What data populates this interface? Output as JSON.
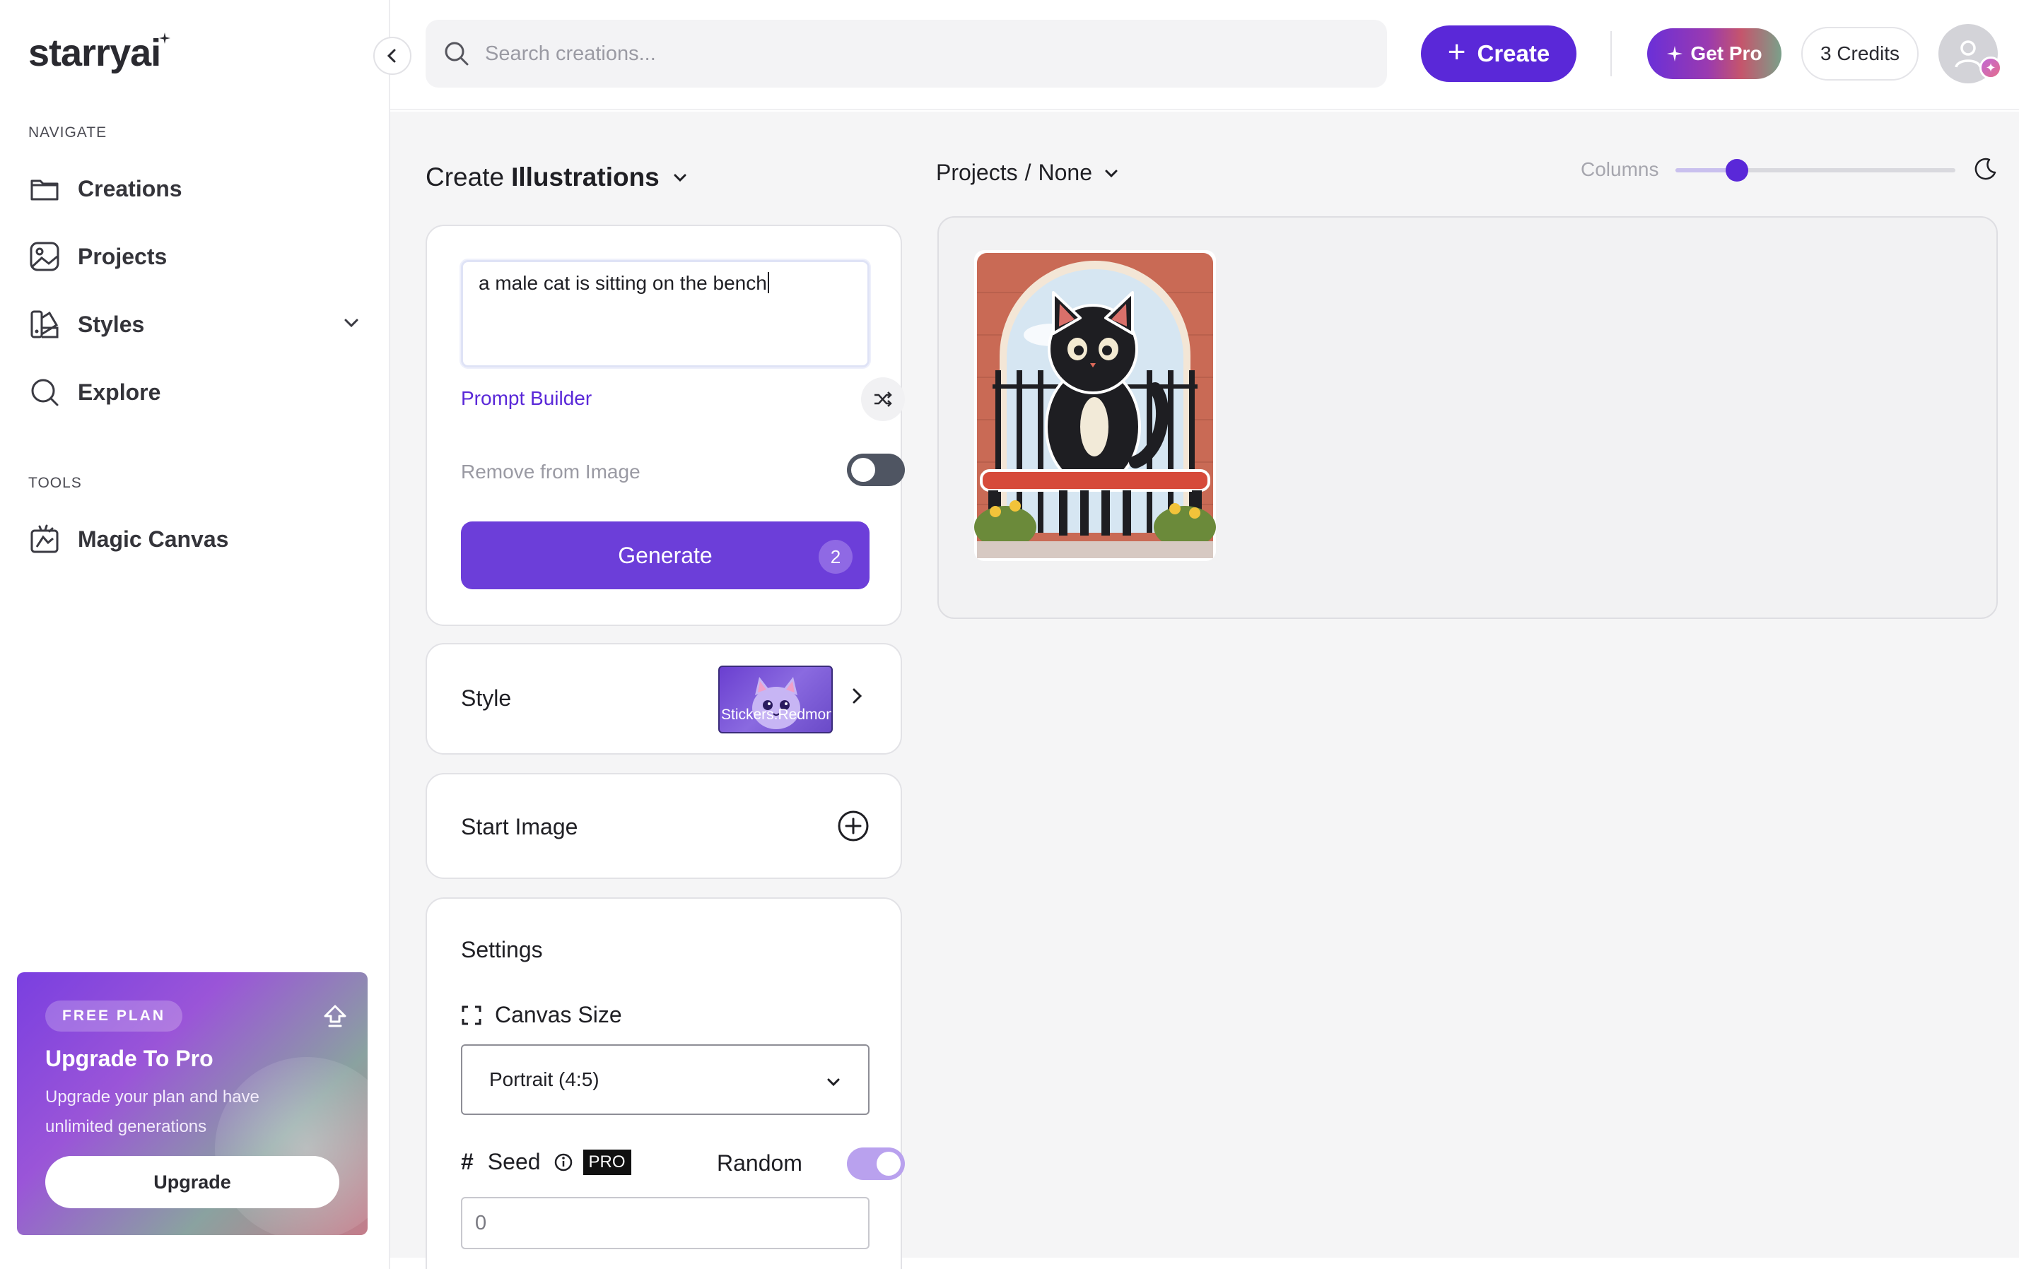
{
  "app": {
    "logo": "starryai"
  },
  "sidebar": {
    "navigate_label": "NAVIGATE",
    "items": [
      {
        "label": "Creations",
        "icon": "folder-icon"
      },
      {
        "label": "Projects",
        "icon": "image-icon"
      },
      {
        "label": "Styles",
        "icon": "palette-icon"
      },
      {
        "label": "Explore",
        "icon": "search-icon"
      }
    ],
    "tools_label": "TOOLS",
    "tools": [
      {
        "label": "Magic Canvas",
        "icon": "magic-canvas-icon"
      }
    ],
    "promo": {
      "badge": "FREE PLAN",
      "title": "Upgrade To Pro",
      "description": "Upgrade your plan and have unlimited generations",
      "button": "Upgrade"
    }
  },
  "header": {
    "search_placeholder": "Search creations...",
    "create_label": "Create",
    "get_pro_label": "Get Pro",
    "credits_label": "3 Credits"
  },
  "create_panel": {
    "title_prefix": "Create",
    "title_type": "Illustrations",
    "prompt_value": "a male cat is sitting on the bench",
    "prompt_builder_label": "Prompt Builder",
    "remove_from_image_label": "Remove from Image",
    "remove_from_image_on": false,
    "generate_label": "Generate",
    "generate_count": "2",
    "style_label": "Style",
    "style_name": "Stickers.Redmond",
    "start_image_label": "Start Image",
    "settings_label": "Settings",
    "canvas_size_label": "Canvas Size",
    "canvas_size_value": "Portrait (4:5)",
    "seed_label": "Seed",
    "pro_tag": "PRO",
    "random_label": "Random",
    "random_on": true,
    "seed_value": "0"
  },
  "gallery": {
    "breadcrumb_root": "Projects",
    "breadcrumb_separator": "/",
    "breadcrumb_current": "None",
    "columns_label": "Columns",
    "columns_value": 0.22,
    "items": [
      {
        "alt": "black cat sticker on a red bench"
      }
    ]
  },
  "colors": {
    "accent": "#5a28d8",
    "generate": "#6c3ed9",
    "main_bg": "#f5f5f6"
  }
}
